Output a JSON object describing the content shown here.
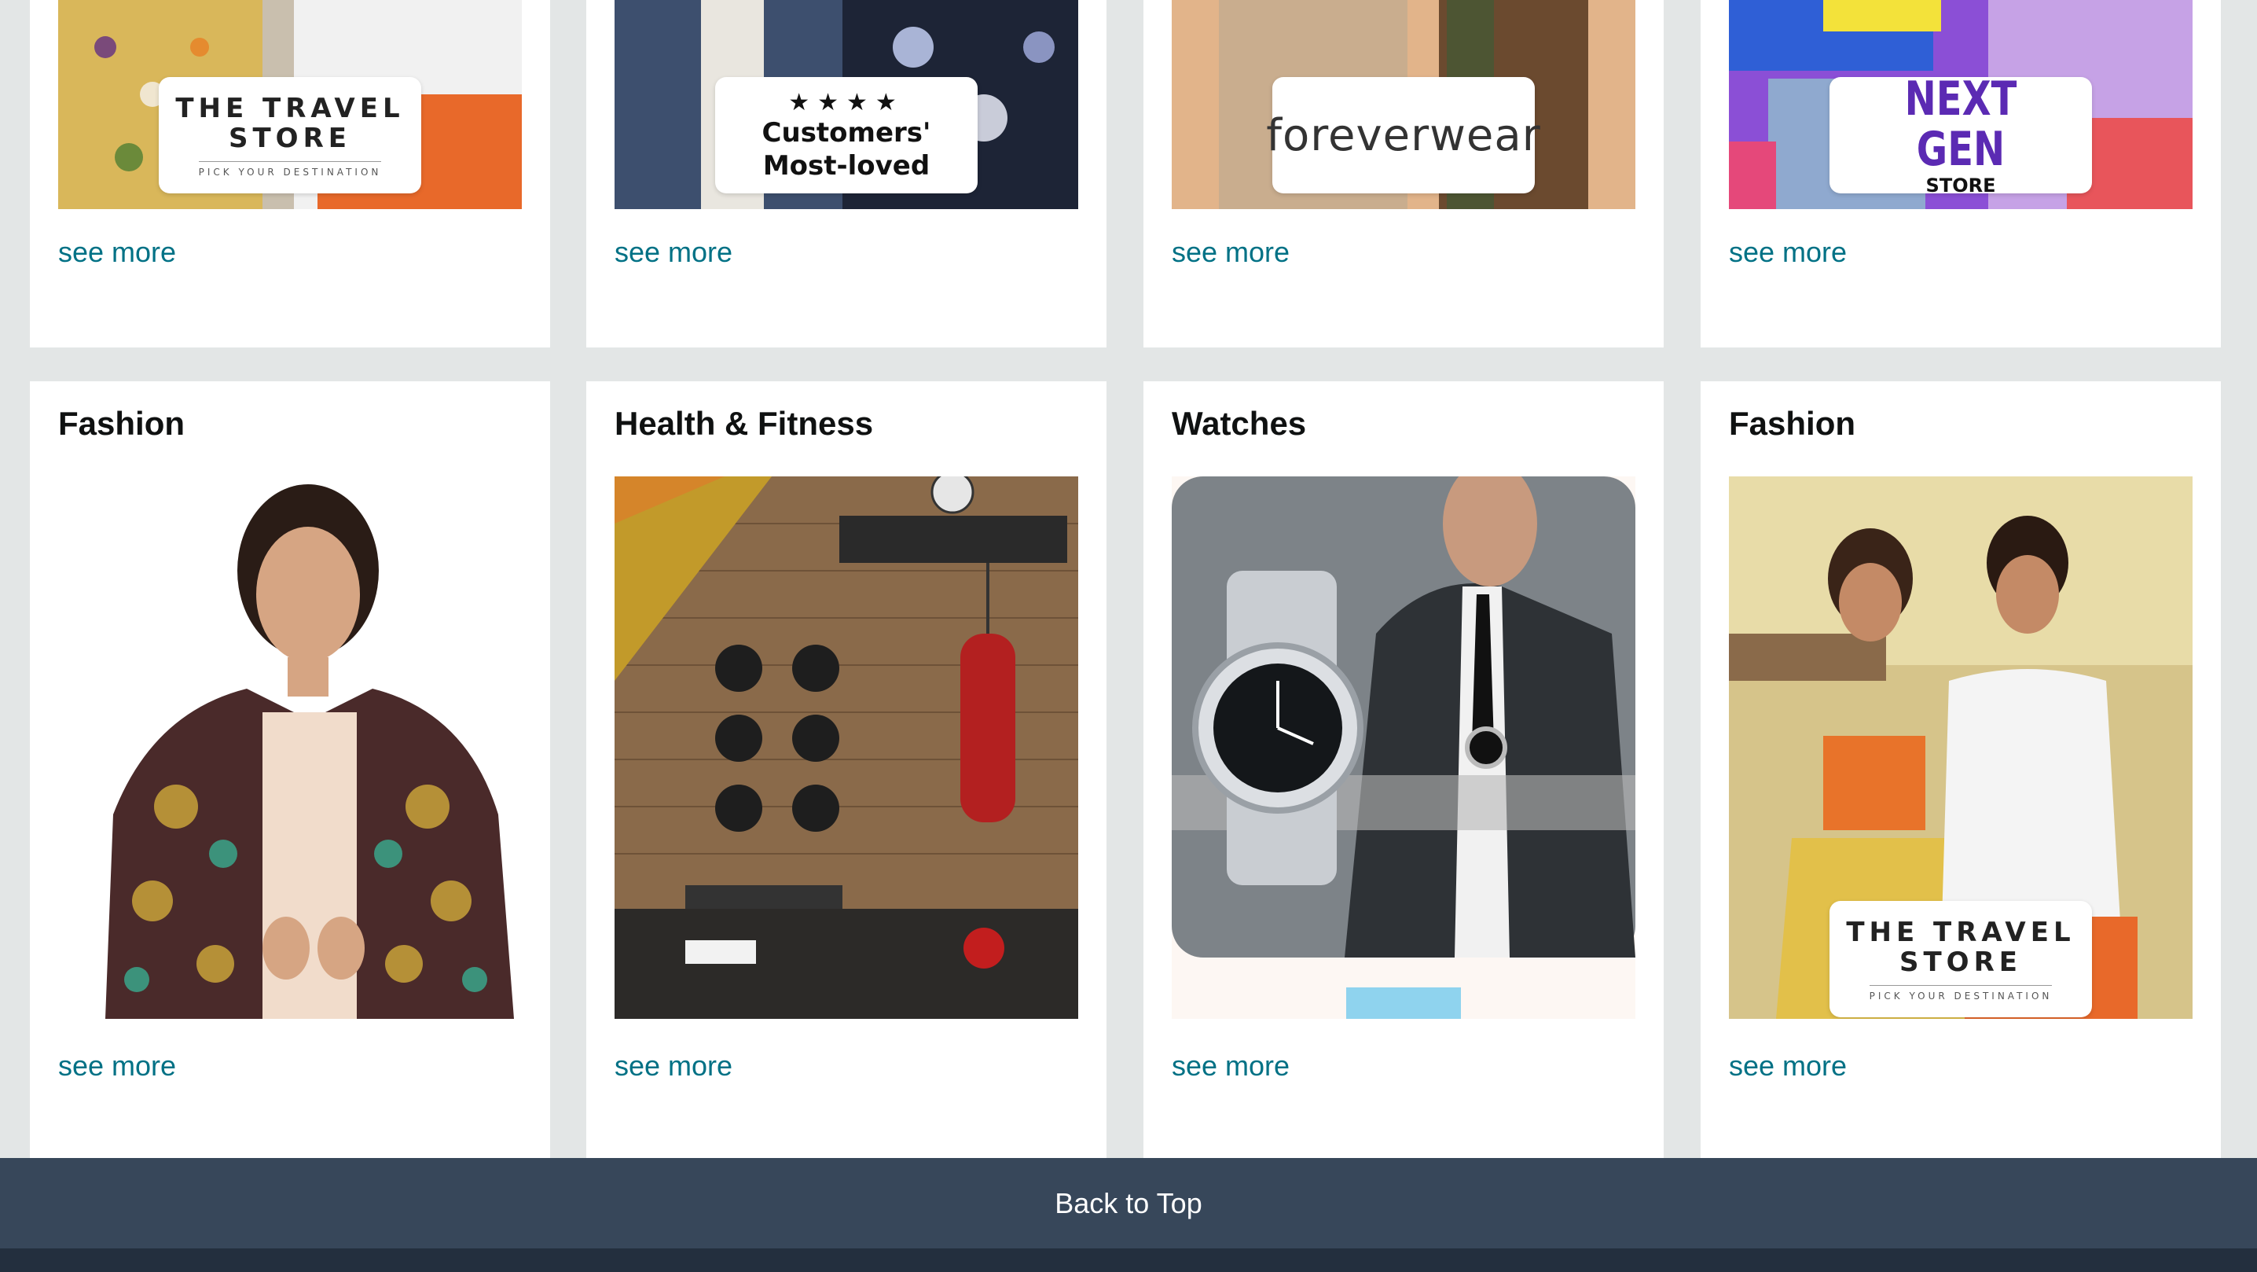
{
  "row1": [
    {
      "badge_type": "travel",
      "badge_line1": "THE TRAVEL",
      "badge_line2": "STORE",
      "badge_sub": "PICK YOUR DESTINATION",
      "see_more": "see more"
    },
    {
      "badge_type": "loved",
      "badge_stars": "★★★★",
      "badge_line1": "Customers'",
      "badge_line2": "Most-loved",
      "see_more": "see more"
    },
    {
      "badge_type": "forever",
      "badge_line1": "foreverwear",
      "see_more": "see more"
    },
    {
      "badge_type": "nextgen",
      "badge_line1": "NEXT GEN",
      "badge_line2": "STORE",
      "see_more": "see more"
    }
  ],
  "row2": [
    {
      "title": "Fashion",
      "image": "woman-in-printed-jacket",
      "see_more": "see more"
    },
    {
      "title": "Health & Fitness",
      "image": "home-gym-wall",
      "see_more": "see more"
    },
    {
      "title": "Watches",
      "image": "silver-wristwatch-and-man-in-suit",
      "see_more": "see more"
    },
    {
      "title": "Fashion",
      "image": "couple-travel-store",
      "badge_line1": "THE TRAVEL",
      "badge_line2": "STORE",
      "badge_sub": "PICK YOUR DESTINATION",
      "see_more": "see more"
    }
  ],
  "footer": {
    "back_to_top": "Back to Top"
  },
  "colors": {
    "page_bg": "#e3e6e6",
    "link": "#007185",
    "footer_bg": "#37475a",
    "footer_bottom": "#232f3e"
  }
}
